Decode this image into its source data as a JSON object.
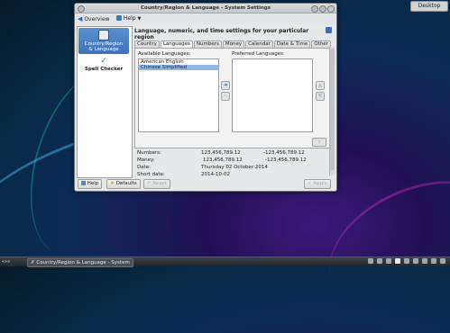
{
  "desktop": {
    "button_label": "Desktop"
  },
  "window": {
    "title": "Country/Region & Language - System Settings",
    "toolbar": {
      "overview_label": "Overview",
      "help_label": "Help"
    },
    "sidebar": {
      "items": [
        {
          "label_line1": "Country/Region",
          "label_line2": "& Language",
          "icon": "globe-flag-icon",
          "selected": true
        },
        {
          "label_line1": "Spell Checker",
          "label_line2": "",
          "icon": "abc-check-icon",
          "selected": false
        }
      ]
    },
    "header": "Language, numeric, and time settings for your particular region",
    "tabs": [
      "Country",
      "Languages",
      "Numbers",
      "Money",
      "Calendar",
      "Date & Time",
      "Other"
    ],
    "active_tab": "Languages",
    "available_languages": {
      "label": "Available Languages:",
      "items": [
        "American English",
        "Chinese Simplified"
      ],
      "selected_index": 1
    },
    "preferred_languages": {
      "label": "Preferred Languages:",
      "items": []
    },
    "info": {
      "numbers": {
        "label": "Numbers:",
        "positive": "123,456,789.12",
        "negative": "-123,456,789.12"
      },
      "money": {
        "label": "Money:",
        "positive": "123,456,789.12",
        "negative": "-123,456,789.12"
      },
      "date": {
        "label": "Date:",
        "value": "Thursday 02 October 2014"
      },
      "short_date": {
        "label": "Short date:",
        "value": "2014-10-02"
      }
    },
    "buttons": {
      "help": "Help",
      "defaults": "Defaults",
      "reset": "Reset",
      "apply": "Apply"
    }
  },
  "taskbar": {
    "task_label": "Country/Region & Language - System",
    "menu_label": "«»«"
  },
  "colors": {
    "accent": "#3d73b9",
    "selection": "#8fb7e6",
    "window_bg": "#e6e7e8"
  }
}
